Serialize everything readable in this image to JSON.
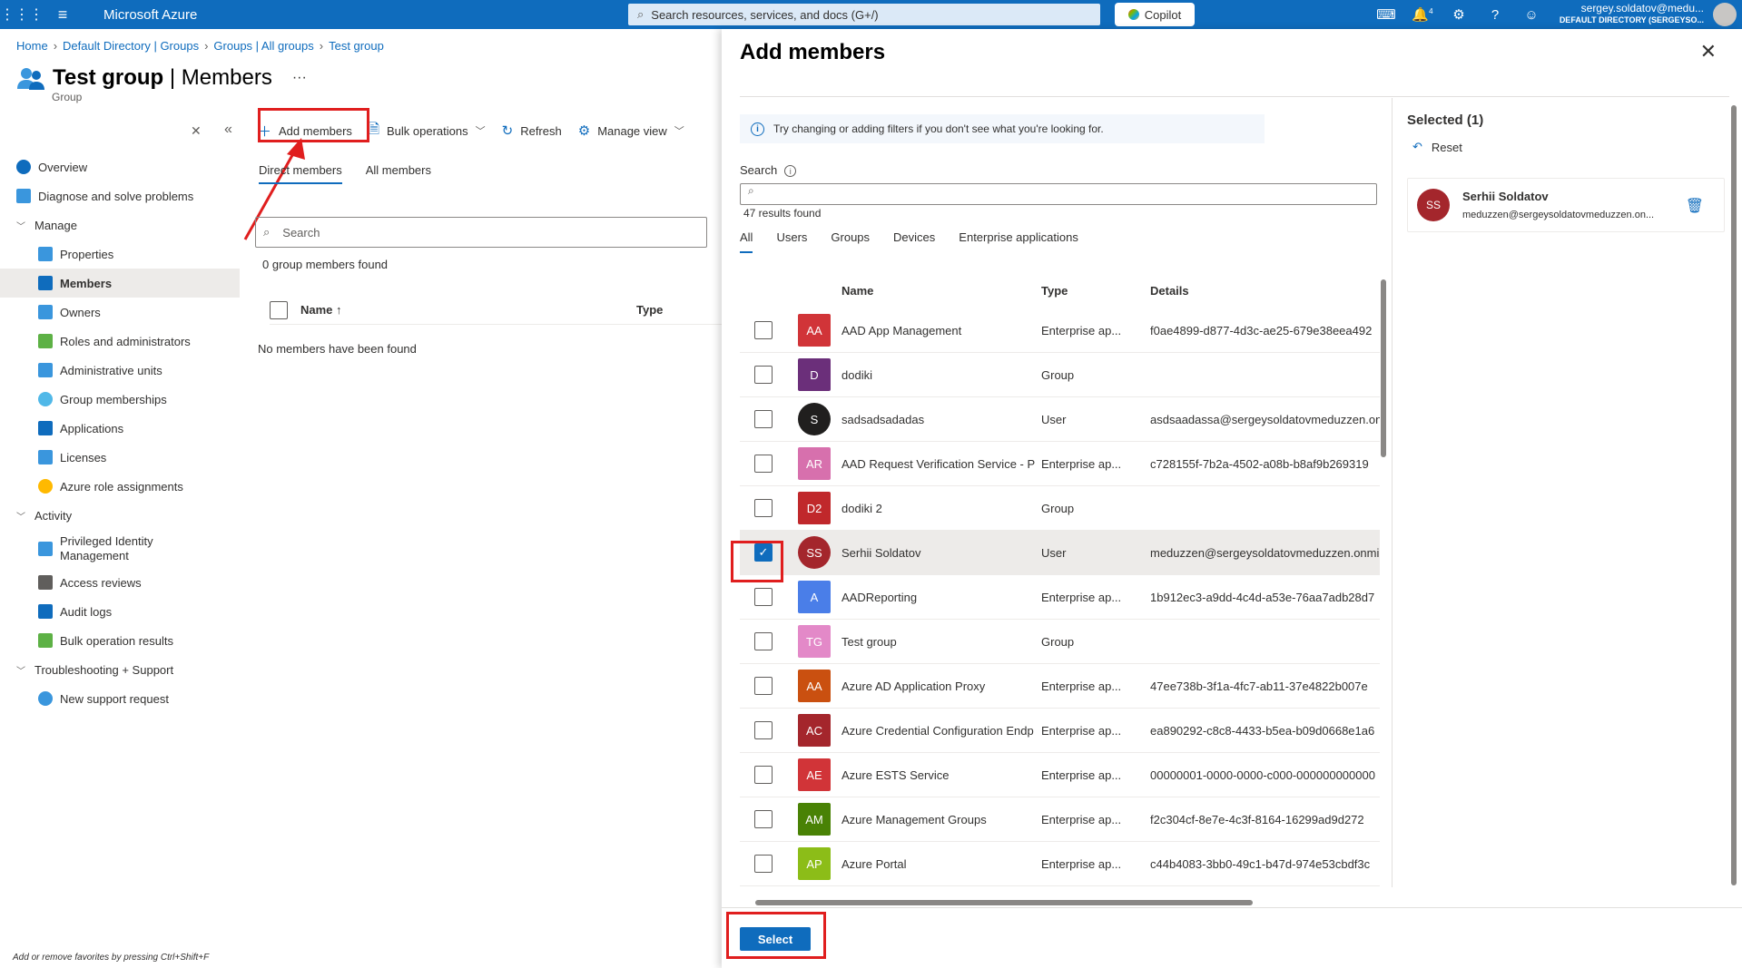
{
  "topbar": {
    "brand": "Microsoft Azure",
    "search_placeholder": "Search resources, services, and docs (G+/)",
    "copilot_label": "Copilot",
    "notification_count": "4",
    "user_email": "sergey.soldatov@medu...",
    "user_directory": "DEFAULT DIRECTORY (SERGEYSO..."
  },
  "breadcrumb": [
    "Home",
    "Default Directory | Groups",
    "Groups | All groups",
    "Test group"
  ],
  "page": {
    "title_bold": "Test group",
    "title_sep": " | ",
    "title_light": "Members",
    "subtitle": "Group",
    "more": "···"
  },
  "nav": {
    "overview": "Overview",
    "diagnose": "Diagnose and solve problems",
    "manage": "Manage",
    "properties": "Properties",
    "members": "Members",
    "owners": "Owners",
    "roles": "Roles and administrators",
    "admin_units": "Administrative units",
    "group_memberships": "Group memberships",
    "applications": "Applications",
    "licenses": "Licenses",
    "azure_roles": "Azure role assignments",
    "activity": "Activity",
    "pim": "Privileged Identity Management",
    "access_reviews": "Access reviews",
    "audit_logs": "Audit logs",
    "bulk_results": "Bulk operation results",
    "troubleshooting": "Troubleshooting + Support",
    "new_support": "New support request"
  },
  "footer_note": "Add or remove favorites by pressing Ctrl+Shift+F",
  "toolbar": {
    "add_members": "Add members",
    "bulk_operations": "Bulk operations",
    "refresh": "Refresh",
    "manage_view": "Manage view"
  },
  "members_view": {
    "tab_direct": "Direct members",
    "tab_all": "All members",
    "search_placeholder": "Search",
    "found": "0 group members found",
    "col_name": "Name ↑",
    "col_type": "Type",
    "empty": "No members have been found"
  },
  "add_panel": {
    "title": "Add members",
    "info": "Try changing or adding filters if you don't see what you're looking for.",
    "search_label": "Search",
    "results": "47 results found",
    "tabs": [
      "All",
      "Users",
      "Groups",
      "Devices",
      "Enterprise applications"
    ],
    "columns": {
      "name": "Name",
      "type": "Type",
      "details": "Details"
    },
    "rows": [
      {
        "initials": "AA",
        "color": "#d13438",
        "round": false,
        "name": "AAD App Management",
        "type": "Enterprise ap...",
        "details": "f0ae4899-d877-4d3c-ae25-679e38eea492",
        "checked": false
      },
      {
        "initials": "D",
        "color": "#6b2f7a",
        "round": false,
        "name": "dodiki",
        "type": "Group",
        "details": "",
        "checked": false
      },
      {
        "initials": "S",
        "color": "#201f1e",
        "round": true,
        "name": "sadsadsadadas",
        "type": "User",
        "details": "asdsaadassa@sergeysoldatovmeduzzen.onmi",
        "checked": false
      },
      {
        "initials": "AR",
        "color": "#d770ad",
        "round": false,
        "name": "AAD Request Verification Service - P",
        "type": "Enterprise ap...",
        "details": "c728155f-7b2a-4502-a08b-b8af9b269319",
        "checked": false
      },
      {
        "initials": "D2",
        "color": "#c0282b",
        "round": false,
        "name": "dodiki 2",
        "type": "Group",
        "details": "",
        "checked": false
      },
      {
        "initials": "SS",
        "color": "#a4262c",
        "round": true,
        "name": "Serhii Soldatov",
        "type": "User",
        "details": "meduzzen@sergeysoldatovmeduzzen.onmi",
        "checked": true
      },
      {
        "initials": "A",
        "color": "#4a7ee8",
        "round": false,
        "name": "AADReporting",
        "type": "Enterprise ap...",
        "details": "1b912ec3-a9dd-4c4d-a53e-76aa7adb28d7",
        "checked": false
      },
      {
        "initials": "TG",
        "color": "#e389c8",
        "round": false,
        "name": "Test group",
        "type": "Group",
        "details": "",
        "checked": false
      },
      {
        "initials": "AA",
        "color": "#ca5010",
        "round": false,
        "name": "Azure AD Application Proxy",
        "type": "Enterprise ap...",
        "details": "47ee738b-3f1a-4fc7-ab11-37e4822b007e",
        "checked": false
      },
      {
        "initials": "AC",
        "color": "#a4262c",
        "round": false,
        "name": "Azure Credential Configuration Endp",
        "type": "Enterprise ap...",
        "details": "ea890292-c8c8-4433-b5ea-b09d0668e1a6",
        "checked": false
      },
      {
        "initials": "AE",
        "color": "#d13438",
        "round": false,
        "name": "Azure ESTS Service",
        "type": "Enterprise ap...",
        "details": "00000001-0000-0000-c000-000000000000",
        "checked": false
      },
      {
        "initials": "AM",
        "color": "#498205",
        "round": false,
        "name": "Azure Management Groups",
        "type": "Enterprise ap...",
        "details": "f2c304cf-8e7e-4c3f-8164-16299ad9d272",
        "checked": false
      },
      {
        "initials": "AP",
        "color": "#8cbd18",
        "round": false,
        "name": "Azure Portal",
        "type": "Enterprise ap...",
        "details": "c44b4083-3bb0-49c1-b47d-974e53cbdf3c",
        "checked": false
      }
    ],
    "selected_header": "Selected (1)",
    "reset": "Reset",
    "selected_item": {
      "initials": "SS",
      "name": "Serhii Soldatov",
      "email": "meduzzen@sergeysoldatovmeduzzen.on..."
    },
    "select_button": "Select"
  }
}
